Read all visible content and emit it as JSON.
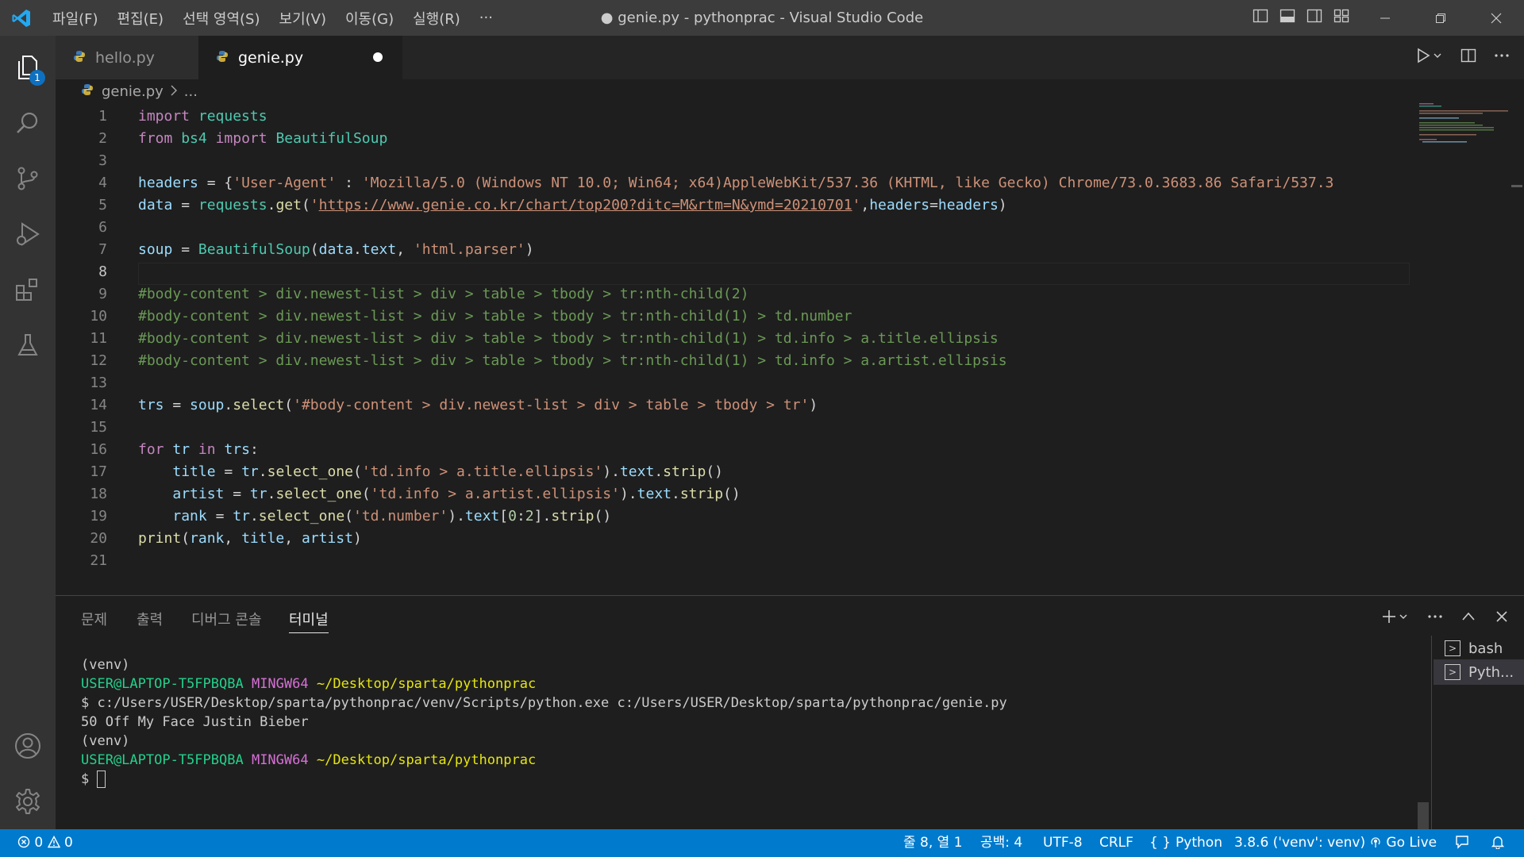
{
  "window": {
    "title": "● genie.py - pythonprac - Visual Studio Code",
    "menu": [
      "파일(F)",
      "편집(E)",
      "선택 영역(S)",
      "보기(V)",
      "이동(G)",
      "실행(R)",
      "···"
    ]
  },
  "activity_bar": {
    "explorer_badge": "1",
    "icons": [
      "files-icon",
      "search-icon",
      "source-control-icon",
      "run-debug-icon",
      "extensions-icon",
      "testing-icon",
      "account-icon",
      "settings-gear-icon"
    ]
  },
  "tabs": [
    {
      "label": "hello.py",
      "active": false
    },
    {
      "label": "genie.py",
      "active": true,
      "modified": true
    }
  ],
  "breadcrumb": {
    "file": "genie.py",
    "rest": "..."
  },
  "editor": {
    "current_line": 8,
    "lines": [
      "1",
      "2",
      "3",
      "4",
      "5",
      "6",
      "7",
      "8",
      "9",
      "10",
      "11",
      "12",
      "13",
      "14",
      "15",
      "16",
      "17",
      "18",
      "19",
      "20",
      "21"
    ],
    "code": {
      "l4_ua": "'Mozilla/5.0 (Windows NT 10.0; Win64; x64)AppleWebKit/537.36 (KHTML, like Gecko) Chrome/73.0.3683.86 Safari/537.3",
      "l5_url": "https://www.genie.co.kr/chart/top200?ditc=M&rtm=N&ymd=20210701",
      "l7_parser": "'html.parser'",
      "l9": "#body-content > div.newest-list > div > table > tbody > tr:nth-child(2)",
      "l10": "#body-content > div.newest-list > div > table > tbody > tr:nth-child(1) > td.number",
      "l11": "#body-content > div.newest-list > div > table > tbody > tr:nth-child(1) > td.info > a.title.ellipsis",
      "l12": "#body-content > div.newest-list > div > table > tbody > tr:nth-child(1) > td.info > a.artist.ellipsis",
      "l14_sel": "'#body-content > div.newest-list > div > table > tbody > tr'",
      "l17_sel": "'td.info > a.title.ellipsis'",
      "l18_sel": "'td.info > a.artist.ellipsis'",
      "l19_sel": "'td.number'"
    }
  },
  "panel": {
    "tabs": [
      "문제",
      "출력",
      "디버그 콘솔",
      "터미널"
    ],
    "active_tab": "터미널",
    "terminal": {
      "venv": "(venv)",
      "user_host": "USER@LAPTOP-T5FPBQBA",
      "shell": "MINGW64",
      "cwd": "~/Desktop/sparta/pythonprac",
      "command": "$ c:/Users/USER/Desktop/sparta/pythonprac/venv/Scripts/python.exe c:/Users/USER/Desktop/sparta/pythonprac/genie.py",
      "output": "50 Off My Face Justin Bieber",
      "prompt": "$ "
    },
    "terminal_list": [
      "bash",
      "Pyth..."
    ]
  },
  "status_bar": {
    "errors": "0",
    "warnings": "0",
    "position": "줄 8, 열 1",
    "indent": "공백: 4",
    "encoding": "UTF-8",
    "eol": "CRLF",
    "language": "Python",
    "interpreter": "3.8.6 ('venv': venv)",
    "go_live": "Go Live"
  },
  "colors": {
    "accent": "#007acc",
    "titlebar": "#3c3c3c",
    "activitybar": "#333333",
    "editor_bg": "#1e1e1e",
    "keyword": "#c586c0",
    "string": "#ce9178",
    "comment": "#6a9955",
    "class": "#4ec9b0",
    "variable": "#9cdcfe",
    "function": "#dcdcaa"
  }
}
